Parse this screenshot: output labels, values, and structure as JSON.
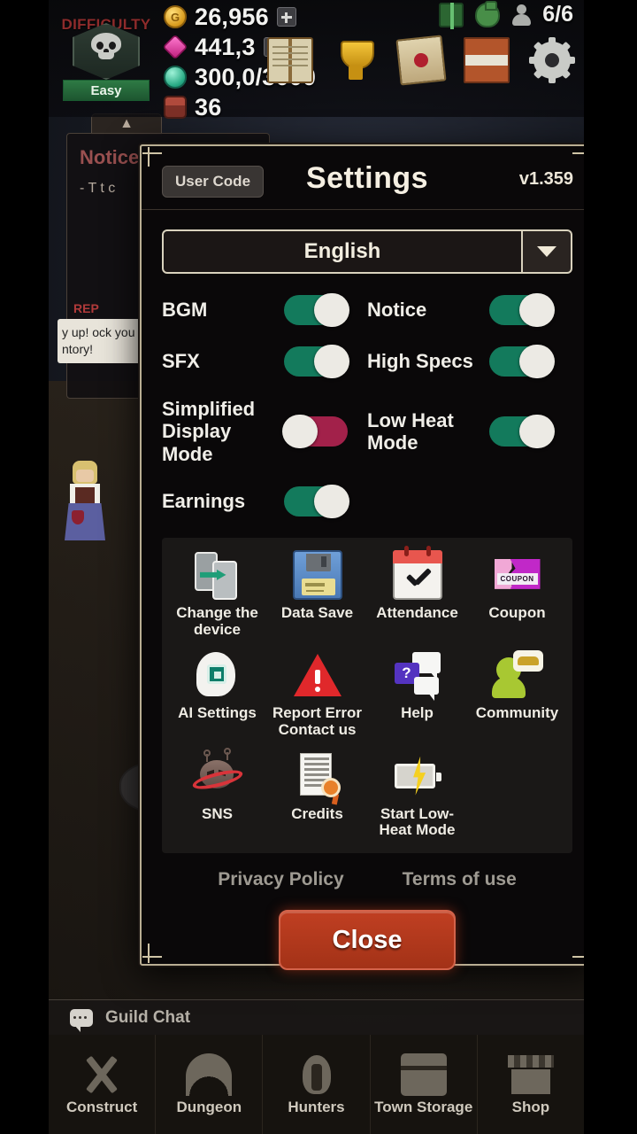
{
  "hud": {
    "difficulty_label": "DIFFICULTY",
    "difficulty_value": "Easy",
    "currencies": [
      {
        "icon": "gold-coin-icon",
        "value": "26,956",
        "has_plus": true
      },
      {
        "icon": "pink-gem-icon",
        "value": "441,3",
        "has_plus": true
      },
      {
        "icon": "green-gem-icon",
        "value": "300,0/3000",
        "has_plus": false
      },
      {
        "icon": "treasure-chest-icon",
        "value": "36",
        "has_plus": false
      }
    ],
    "party_count": "6/6",
    "top_icons": [
      "gift-icon",
      "money-bag-icon",
      "person-icon"
    ],
    "menu_icons": [
      "book-icon",
      "trophy-icon",
      "mail-icon",
      "banner-icon",
      "gear-icon"
    ]
  },
  "background": {
    "notice_tab": "▲",
    "notice_title": "Notice",
    "notice_body": "- T\nt\nc",
    "red_tag": "REP",
    "hurry_text": "y up!\nock you\nntory!"
  },
  "settings": {
    "user_code_label": "User Code",
    "title": "Settings",
    "version": "v1.359",
    "language": "English",
    "toggles": [
      {
        "label": "BGM",
        "state": "on"
      },
      {
        "label": "Notice",
        "state": "on"
      },
      {
        "label": "SFX",
        "state": "on"
      },
      {
        "label": "High Specs",
        "state": "on"
      },
      {
        "label": "Simplified Display Mode",
        "state": "off"
      },
      {
        "label": "Low Heat Mode",
        "state": "on"
      },
      {
        "label": "Earnings",
        "state": "on"
      }
    ],
    "grid": [
      {
        "label": "Change the device",
        "icon": "device-transfer-icon"
      },
      {
        "label": "Data Save",
        "icon": "floppy-disk-icon"
      },
      {
        "label": "Attendance",
        "icon": "calendar-check-icon"
      },
      {
        "label": "Coupon",
        "icon": "coupon-ticket-icon",
        "ticket_text": "COUPON"
      },
      {
        "label": "AI Settings",
        "icon": "ai-head-chip-icon"
      },
      {
        "label": "Report Error Contact us",
        "icon": "warning-triangle-icon"
      },
      {
        "label": "Help",
        "icon": "question-bubble-icon",
        "bubble_text": "?"
      },
      {
        "label": "Community",
        "icon": "community-person-icon"
      },
      {
        "label": "SNS",
        "icon": "planet-alien-icon"
      },
      {
        "label": "Credits",
        "icon": "document-seal-icon"
      },
      {
        "label": "Start Low-Heat Mode",
        "icon": "battery-bolt-icon"
      }
    ],
    "privacy_policy": "Privacy Policy",
    "terms_of_use": "Terms of use",
    "close_label": "Close"
  },
  "chat": {
    "label": "Guild Chat",
    "icon": "chat-bubble-icon"
  },
  "nav": [
    {
      "label": "Construct",
      "icon": "hammer-pickaxe-icon"
    },
    {
      "label": "Dungeon",
      "icon": "arch-gate-icon"
    },
    {
      "label": "Hunters",
      "icon": "winged-hunter-icon"
    },
    {
      "label": "Town Storage",
      "icon": "chest-icon"
    },
    {
      "label": "Shop",
      "icon": "storefront-icon"
    }
  ],
  "colors": {
    "toggle_on": "#137a5c",
    "toggle_off": "#a2214a",
    "close_button": "#b8381d",
    "modal_border": "#b9ae93"
  }
}
